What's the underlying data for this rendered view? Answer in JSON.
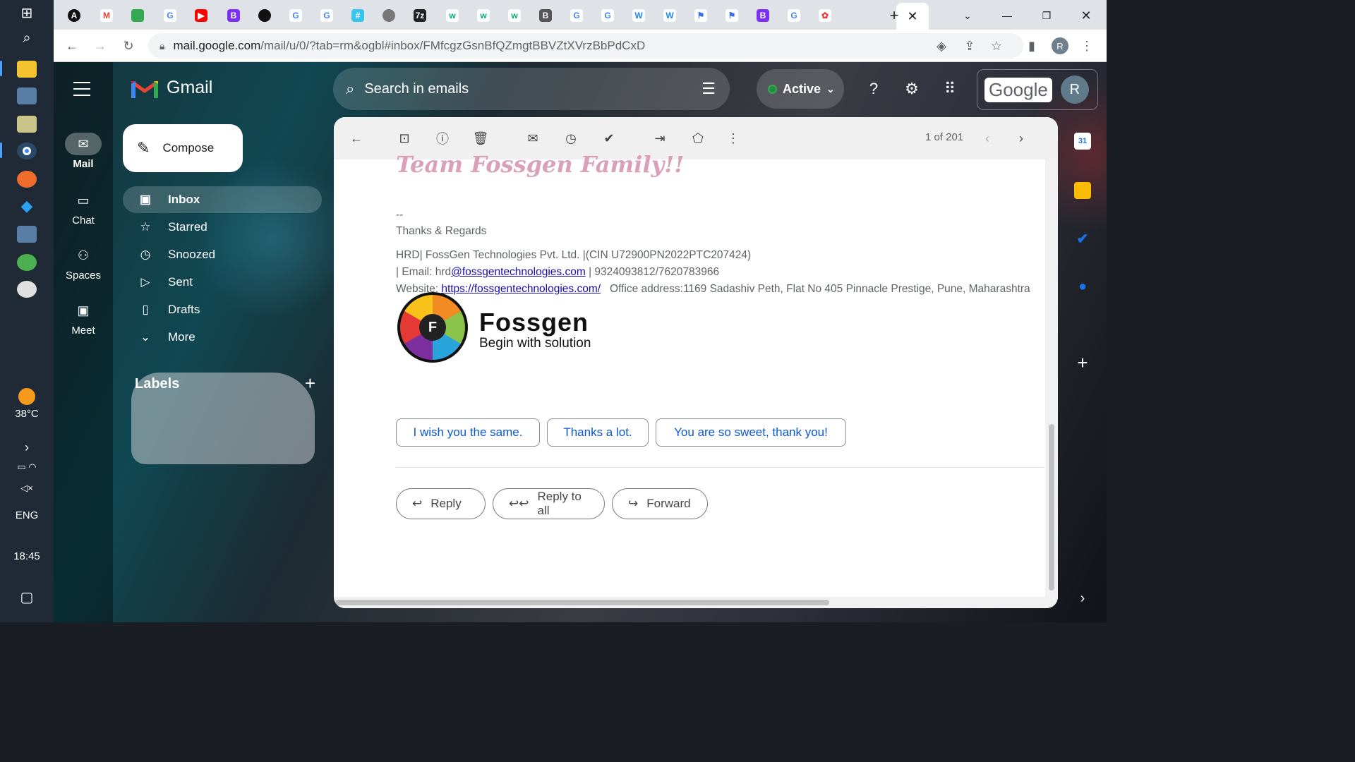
{
  "taskbar": {
    "temperature": "38°C",
    "language": "ENG",
    "time": "18:45"
  },
  "browser": {
    "url_host": "mail.google.com",
    "url_path": "/mail/u/0/?tab=rm&ogbl#inbox/FMfcgzGsnBfQZmgtBBVZtXVrzBbPdCxD",
    "profile_initial": "R"
  },
  "gmail": {
    "brand": "Gmail",
    "rail": {
      "mail": "Mail",
      "chat": "Chat",
      "spaces": "Spaces",
      "meet": "Meet"
    },
    "compose": "Compose",
    "nav": [
      "Inbox",
      "Starred",
      "Snoozed",
      "Sent",
      "Drafts",
      "More"
    ],
    "labels_heading": "Labels",
    "search_placeholder": "Search in emails",
    "status": "Active",
    "google_word": "Google",
    "avatar_initial": "R",
    "pagination": "1 of 201"
  },
  "message": {
    "signoff": "Team Fossgen Family!!",
    "dashes": "--",
    "thanks": "Thanks & Regards",
    "company_line": "HRD| FossGen Technologies Pvt. Ltd. |(CIN U72900PN2022PTC207424)",
    "email_prefix": "| Email: hrd",
    "email_link": "@fossgentechnologies.com",
    "phones": " | 9324093812/7620783966",
    "website_prefix": "Website: ",
    "website_link": "https://fossgentechnologies.com/",
    "office": "   Office address:1169 Sadashiv Peth, Flat No 405 Pinnacle Prestige, Pune, Maharashtra",
    "logo_letter": "F",
    "logo_name": "Fossgen",
    "logo_tagline": "Begin with solution",
    "smart_replies": [
      "I wish you the same.",
      "Thanks a lot.",
      "You are so sweet, thank you!"
    ],
    "reply": "Reply",
    "reply_all": "Reply to all",
    "forward": "Forward"
  },
  "colors": {
    "accent": "#0b57d0",
    "active_green": "#1e8e3e"
  }
}
